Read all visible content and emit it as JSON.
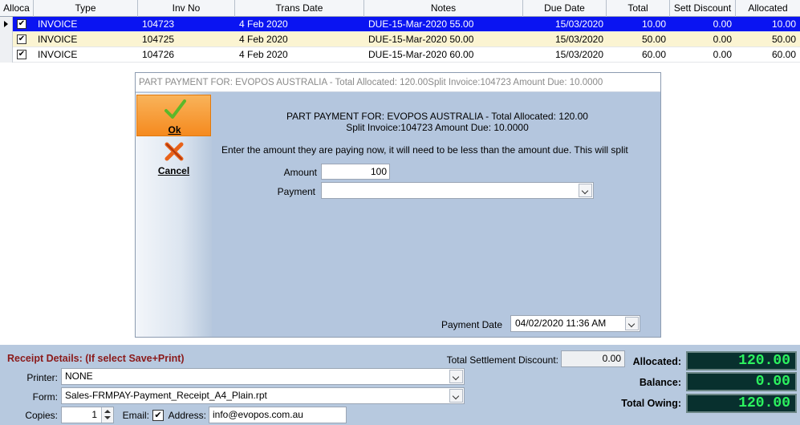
{
  "grid": {
    "headers": [
      "Alloca",
      "Type",
      "Inv No",
      "Trans Date",
      "Notes",
      "Due Date",
      "Total",
      "Sett Discount",
      "Allocated"
    ],
    "rows": [
      {
        "type": "INVOICE",
        "inv_no": "104723",
        "trans_date": "4 Feb 2020",
        "notes": "DUE-15-Mar-2020 55.00",
        "due_date": "15/03/2020",
        "total": "10.00",
        "sett_discount": "0.00",
        "allocated": "10.00",
        "checked": true
      },
      {
        "type": "INVOICE",
        "inv_no": "104725",
        "trans_date": "4 Feb 2020",
        "notes": "DUE-15-Mar-2020 50.00",
        "due_date": "15/03/2020",
        "total": "50.00",
        "sett_discount": "0.00",
        "allocated": "50.00",
        "checked": true
      },
      {
        "type": "INVOICE",
        "inv_no": "104726",
        "trans_date": "4 Feb 2020",
        "notes": "DUE-15-Mar-2020 60.00",
        "due_date": "15/03/2020",
        "total": "60.00",
        "sett_discount": "0.00",
        "allocated": "60.00",
        "checked": true
      }
    ],
    "check_mark": "✔"
  },
  "dialog": {
    "title": "PART PAYMENT FOR: EVOPOS AUSTRALIA - Total Allocated: 120.00Split Invoice:104723 Amount Due: 10.0000",
    "ok_label": "Ok",
    "cancel_label": "Cancel",
    "message_line1": "PART PAYMENT FOR: EVOPOS AUSTRALIA - Total Allocated: 120.00",
    "message_line2": "Split Invoice:104723 Amount Due: 10.0000",
    "instruction": "Enter the amount they are paying now, it will need to be less than the amount due. This will split",
    "amount_label": "Amount",
    "amount_value": "100",
    "payment_label": "Payment",
    "payment_value": "",
    "payment_date_label": "Payment Date",
    "payment_date_value": "04/02/2020 11:36 AM"
  },
  "receipt": {
    "title": "Receipt Details: (If select Save+Print)",
    "printer_label": "Printer:",
    "printer_value": "NONE",
    "form_label": "Form:",
    "form_value": "Sales-FRMPAY-Payment_Receipt_A4_Plain.rpt",
    "copies_label": "Copies:",
    "copies_value": "1",
    "email_label": "Email:",
    "email_checked": "✔",
    "address_label": "Address:",
    "address_value": "info@evopos.com.au"
  },
  "totals": {
    "settlement_label": "Total Settlement Discount:",
    "settlement_value": "0.00",
    "allocated_label": "Allocated:",
    "allocated_value": "120.00",
    "balance_label": "Balance:",
    "balance_value": "0.00",
    "owing_label": "Total Owing:",
    "owing_value": "120.00"
  },
  "colors": {
    "selected_row": "#0a14f2",
    "alt_row": "#fbf4d2",
    "ok_button": "#f58a1f",
    "display_text": "#2cf25f",
    "receipt_title": "#8b1a1a"
  }
}
